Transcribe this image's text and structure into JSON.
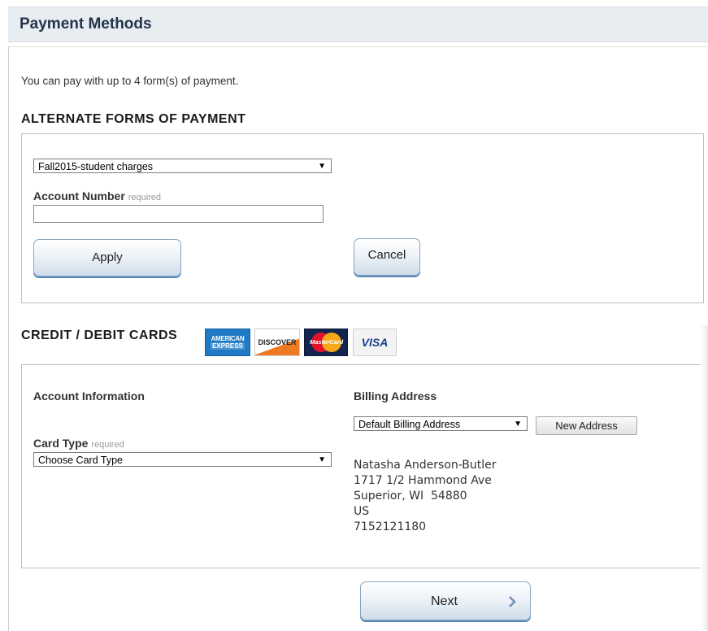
{
  "header": {
    "title": "Payment Methods"
  },
  "intro": "You can pay with up to 4 form(s) of payment.",
  "alternate": {
    "title": "ALTERNATE FORMS OF PAYMENT",
    "select_value": "Fall2015-student charges",
    "account_label": "Account Number",
    "required": "required",
    "account_value": "",
    "apply": "Apply",
    "cancel": "Cancel"
  },
  "cards": {
    "title": "CREDIT / DEBIT CARDS",
    "logos": {
      "amex_line1": "AMERICAN",
      "amex_line2": "EXPRESS",
      "discover": "DISCOVER",
      "mastercard": "MasterCard",
      "visa": "VISA"
    },
    "account_info_title": "Account Information",
    "card_type_label": "Card Type",
    "required": "required",
    "card_type_value": "Choose Card Type",
    "billing_title": "Billing Address",
    "billing_select_value": "Default Billing Address",
    "new_address": "New Address",
    "address": {
      "name": "Natasha Anderson-Butler",
      "street": "1717 1/2 Hammond Ave",
      "city": "Superior, WI  54880",
      "country": "US",
      "phone": "7152121180"
    }
  },
  "next": "Next",
  "colors": {
    "header_bg": "#e8edf2",
    "button_accent": "#5b87b8"
  }
}
